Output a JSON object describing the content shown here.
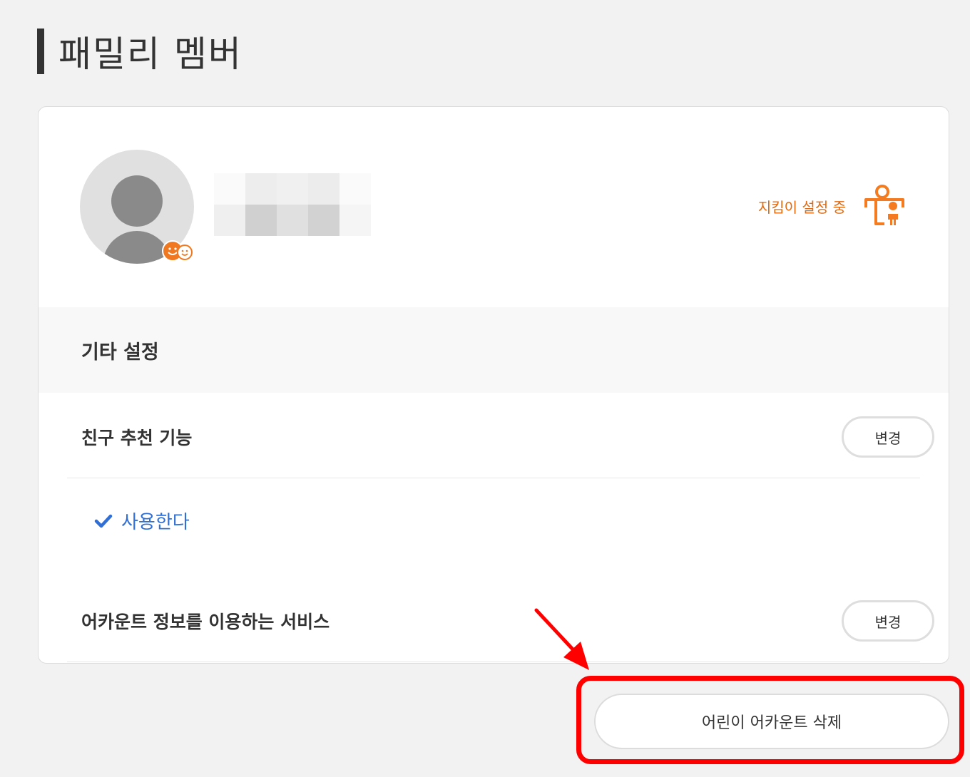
{
  "page": {
    "title": "패밀리 멤버"
  },
  "profile": {
    "guardian_status": "지킴이 설정 중"
  },
  "other_settings": {
    "title": "기타 설정",
    "friend_recommend": {
      "label": "친구 추천 기능",
      "button": "변경",
      "current_value": "사용한다"
    },
    "account_services": {
      "label": "어카운트 정보를 이용하는 서비스",
      "button": "변경"
    }
  },
  "delete_button": {
    "label": "어린이 어카운트 삭제"
  },
  "colors": {
    "accent_orange": "#e06a12",
    "link_blue": "#2f6fd6",
    "highlight_red": "#ff0000",
    "background": "#f2f2f2"
  },
  "icons": [
    "avatar-placeholder-icon",
    "kids-badge-icon",
    "guardian-icon",
    "checkmark-icon",
    "red-arrow-annotation"
  ]
}
